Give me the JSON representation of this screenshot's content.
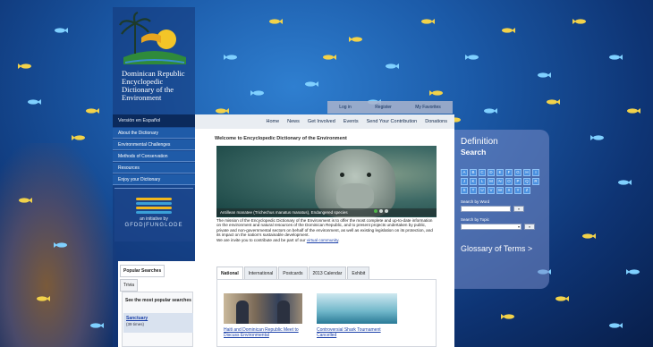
{
  "site": {
    "title": "Dominican Republic Encyclopedic Dictionary of the Environment"
  },
  "top_links": [
    "Log in",
    "Register",
    "My Favorites"
  ],
  "main_nav": [
    "Home",
    "News",
    "Get Involved",
    "Events",
    "Send Your Contribution",
    "Donations"
  ],
  "sidebar": {
    "language_link": "Versión en Español",
    "items": [
      {
        "label": "About the Dictionary"
      },
      {
        "label": "Environmental Challenges"
      },
      {
        "label": "Methods of Conservation"
      },
      {
        "label": "Resources"
      },
      {
        "label": "Enjoy your Dictionary"
      }
    ],
    "initiative_text": "an initiative by",
    "initiative_org": "GFDD|FUNGLODE"
  },
  "content": {
    "welcome": "Welcome to Encyclopedic Dictionary of the Environment",
    "hero_caption": "Antillean manatee (Trichechus manatus manatus), Endangered species",
    "mission": "The mission of the Encyclopedic Dictionary of the Environment is to offer the most complete and up-to-date information on the environment and natural resources of the Dominican Republic, and to present projects undertaken by public, private and non-governmental sectors on behalf of the environment, as well as existing legislation on its protection, and its impact on the nation's sustainable development.",
    "invite_text": "We are invite you to contribute and be part of our",
    "invite_link": "virtual community",
    "tabs": [
      {
        "label": "National",
        "active": true
      },
      {
        "label": "International",
        "active": false
      },
      {
        "label": "Postcards",
        "active": false
      },
      {
        "label": "2013 Calendar",
        "active": false
      },
      {
        "label": "Exhibit",
        "active": false
      }
    ],
    "news": [
      {
        "title": "Haiti and Dominican Republic Meet to Discuss Environmental"
      },
      {
        "title": "Controversial Shark Tournament Cancelled"
      }
    ]
  },
  "popular": {
    "tabs": [
      {
        "label": "Popular Searches",
        "active": true
      },
      {
        "label": "Trivia",
        "active": false
      }
    ],
    "heading": "See the most popular searches",
    "item": {
      "term": "Sanctuary",
      "count": "(39 times)"
    }
  },
  "search_panel": {
    "title": "Definition",
    "subtitle": "Search",
    "letters": [
      "A",
      "B",
      "C",
      "D",
      "E",
      "F",
      "G",
      "H",
      "I",
      "J",
      "K",
      "L",
      "M",
      "N",
      "O",
      "P",
      "Q",
      "R",
      "S",
      "T",
      "U",
      "V",
      "W",
      "X",
      "Y",
      "Z"
    ],
    "by_word_label": "Search by Word",
    "by_topic_label": "Search by Topic",
    "go_label": "»",
    "glossary_link": "Glossary of Terms >"
  },
  "colors": {
    "ocean": "#1b5aa8",
    "nav_blue": "#1f5ba8",
    "link": "#1a3fa8",
    "panel": "#7a8cc8"
  }
}
